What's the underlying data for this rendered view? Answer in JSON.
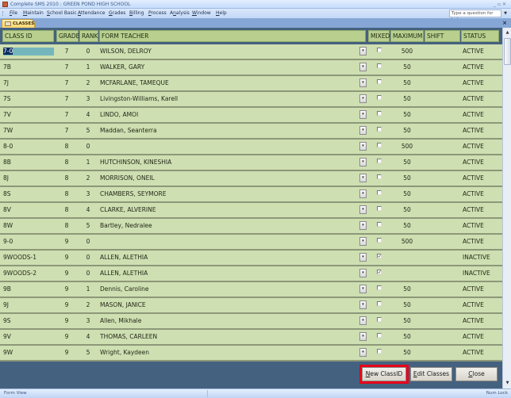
{
  "window": {
    "title": "Complete SMS 2010 : GREEN POND HIGH SCHOOL",
    "controls": [
      "minimize",
      "restore",
      "close"
    ]
  },
  "menu": {
    "items": [
      {
        "label": "File",
        "accel": "F"
      },
      {
        "label": "Maintain",
        "accel": "M"
      },
      {
        "label": "School Basic",
        "accel": "S"
      },
      {
        "label": "Attendance",
        "accel": "A"
      },
      {
        "label": "Grades",
        "accel": "G"
      },
      {
        "label": "Billing",
        "accel": "B"
      },
      {
        "label": "Process",
        "accel": "P"
      },
      {
        "label": "Analysis",
        "accel": "n"
      },
      {
        "label": "Window",
        "accel": "W"
      },
      {
        "label": "Help",
        "accel": "H"
      }
    ],
    "help_placeholder": "Type a question for help"
  },
  "tab": {
    "label": "CLASSES",
    "close_icon": "×"
  },
  "grid": {
    "columns": [
      "CLASS ID",
      "GRADE",
      "RANK",
      "FORM TEACHER",
      "MIXED",
      "MAXIMUM",
      "SHIFT",
      "STATUS"
    ],
    "rows": [
      {
        "class_id": "7-0",
        "grade": "7",
        "rank": "0",
        "teacher": "WILSON, DELROY",
        "mixed": false,
        "maximum": "500",
        "shift": "",
        "status": "ACTIVE",
        "selected": true
      },
      {
        "class_id": "7B",
        "grade": "7",
        "rank": "1",
        "teacher": "WALKER, GARY",
        "mixed": false,
        "maximum": "50",
        "shift": "",
        "status": "ACTIVE"
      },
      {
        "class_id": "7J",
        "grade": "7",
        "rank": "2",
        "teacher": "MCFARLANE, TAMEQUE",
        "mixed": false,
        "maximum": "50",
        "shift": "",
        "status": "ACTIVE"
      },
      {
        "class_id": "7S",
        "grade": "7",
        "rank": "3",
        "teacher": "Livingston-Williams, Karell",
        "mixed": false,
        "maximum": "50",
        "shift": "",
        "status": "ACTIVE"
      },
      {
        "class_id": "7V",
        "grade": "7",
        "rank": "4",
        "teacher": "LINDO, AMOI",
        "mixed": false,
        "maximum": "50",
        "shift": "",
        "status": "ACTIVE"
      },
      {
        "class_id": "7W",
        "grade": "7",
        "rank": "5",
        "teacher": "Maddan, Seanterra",
        "mixed": false,
        "maximum": "50",
        "shift": "",
        "status": "ACTIVE"
      },
      {
        "class_id": "8-0",
        "grade": "8",
        "rank": "0",
        "teacher": "",
        "mixed": false,
        "maximum": "500",
        "shift": "",
        "status": "ACTIVE"
      },
      {
        "class_id": "8B",
        "grade": "8",
        "rank": "1",
        "teacher": "HUTCHINSON, KINESHIA",
        "mixed": false,
        "maximum": "50",
        "shift": "",
        "status": "ACTIVE"
      },
      {
        "class_id": "8J",
        "grade": "8",
        "rank": "2",
        "teacher": "MORRISON, ONEIL",
        "mixed": false,
        "maximum": "50",
        "shift": "",
        "status": "ACTIVE"
      },
      {
        "class_id": "8S",
        "grade": "8",
        "rank": "3",
        "teacher": "CHAMBERS, SEYMORE",
        "mixed": false,
        "maximum": "50",
        "shift": "",
        "status": "ACTIVE"
      },
      {
        "class_id": "8V",
        "grade": "8",
        "rank": "4",
        "teacher": "CLARKE, ALVERINE",
        "mixed": false,
        "maximum": "50",
        "shift": "",
        "status": "ACTIVE"
      },
      {
        "class_id": "8W",
        "grade": "8",
        "rank": "5",
        "teacher": "Bartley, Nedralee",
        "mixed": false,
        "maximum": "50",
        "shift": "",
        "status": "ACTIVE"
      },
      {
        "class_id": "9-0",
        "grade": "9",
        "rank": "0",
        "teacher": "",
        "mixed": false,
        "maximum": "500",
        "shift": "",
        "status": "ACTIVE"
      },
      {
        "class_id": "9WOODS-1",
        "grade": "9",
        "rank": "0",
        "teacher": "ALLEN, ALETHIA",
        "mixed": true,
        "maximum": "",
        "shift": "",
        "status": "INACTIVE"
      },
      {
        "class_id": "9WOODS-2",
        "grade": "9",
        "rank": "0",
        "teacher": "ALLEN, ALETHIA",
        "mixed": true,
        "maximum": "",
        "shift": "",
        "status": "INACTIVE"
      },
      {
        "class_id": "9B",
        "grade": "9",
        "rank": "1",
        "teacher": "Dennis, Caroline",
        "mixed": false,
        "maximum": "50",
        "shift": "",
        "status": "ACTIVE"
      },
      {
        "class_id": "9J",
        "grade": "9",
        "rank": "2",
        "teacher": "MASON, JANICE",
        "mixed": false,
        "maximum": "50",
        "shift": "",
        "status": "ACTIVE"
      },
      {
        "class_id": "9S",
        "grade": "9",
        "rank": "3",
        "teacher": "Allen, Mikhale",
        "mixed": false,
        "maximum": "50",
        "shift": "",
        "status": "ACTIVE"
      },
      {
        "class_id": "9V",
        "grade": "9",
        "rank": "4",
        "teacher": "THOMAS, CARLEEN",
        "mixed": false,
        "maximum": "50",
        "shift": "",
        "status": "ACTIVE"
      },
      {
        "class_id": "9W",
        "grade": "9",
        "rank": "5",
        "teacher": "Wright, Kaydeen",
        "mixed": false,
        "maximum": "50",
        "shift": "",
        "status": "ACTIVE"
      }
    ]
  },
  "buttons": {
    "new_class": {
      "label": "New ClassID",
      "accel": "N",
      "highlighted": true,
      "highlight_color": "#e8001a"
    },
    "edit_classes": {
      "label": "Edit Classes",
      "accel": "E"
    },
    "close": {
      "label": "Close",
      "accel": "C"
    }
  },
  "statusbar": {
    "left": "Form View",
    "right": "Num Lock"
  },
  "colors": {
    "row_bg": "#cedfb2",
    "header_bg": "#b9cf8e",
    "form_bg": "#44617f",
    "selection": "#74b6bc"
  }
}
